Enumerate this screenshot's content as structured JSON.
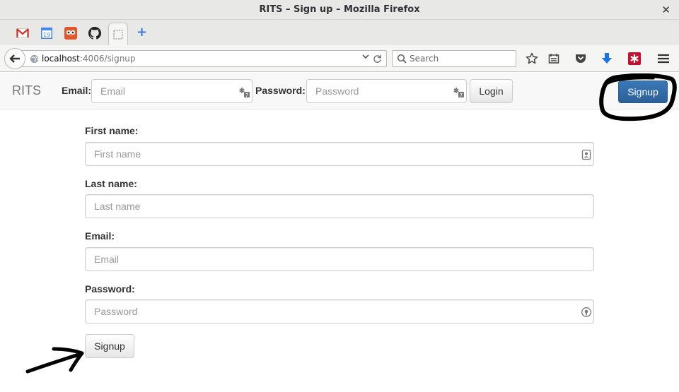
{
  "window": {
    "title": "RITS – Sign up – Mozilla Firefox",
    "close_glyph": "✕"
  },
  "tabs": {
    "pinned": [
      {
        "name": "gmail-icon",
        "color": "#d93025"
      },
      {
        "name": "calendar-icon",
        "label": "19",
        "color": "#4285f4"
      },
      {
        "name": "owl-icon",
        "color": "#e2562c"
      },
      {
        "name": "github-icon",
        "color": "#222222"
      },
      {
        "name": "blank-tab-icon",
        "active": true
      }
    ],
    "new_tab_glyph": "+"
  },
  "navbar": {
    "url_host": "localhost",
    "url_path": ":4006/signup",
    "search_placeholder": "Search",
    "icons": [
      "bookmark-star-icon",
      "reading-list-icon",
      "pocket-icon",
      "download-icon",
      "lastpass-icon",
      "menu-icon"
    ]
  },
  "app": {
    "brand": "RITS",
    "login": {
      "email_label": "Email:",
      "email_placeholder": "Email",
      "password_label": "Password:",
      "password_placeholder": "Password",
      "login_button": "Login"
    },
    "signup_button": "Signup"
  },
  "form": {
    "fields": [
      {
        "label": "First name:",
        "placeholder": "First name"
      },
      {
        "label": "Last name:",
        "placeholder": "Last name"
      },
      {
        "label": "Email:",
        "placeholder": "Email"
      },
      {
        "label": "Password:",
        "placeholder": "Password"
      }
    ],
    "submit_label": "Signup"
  },
  "colors": {
    "primary": "#337ab7",
    "brand_text": "#777777",
    "annotation": "#000000"
  }
}
